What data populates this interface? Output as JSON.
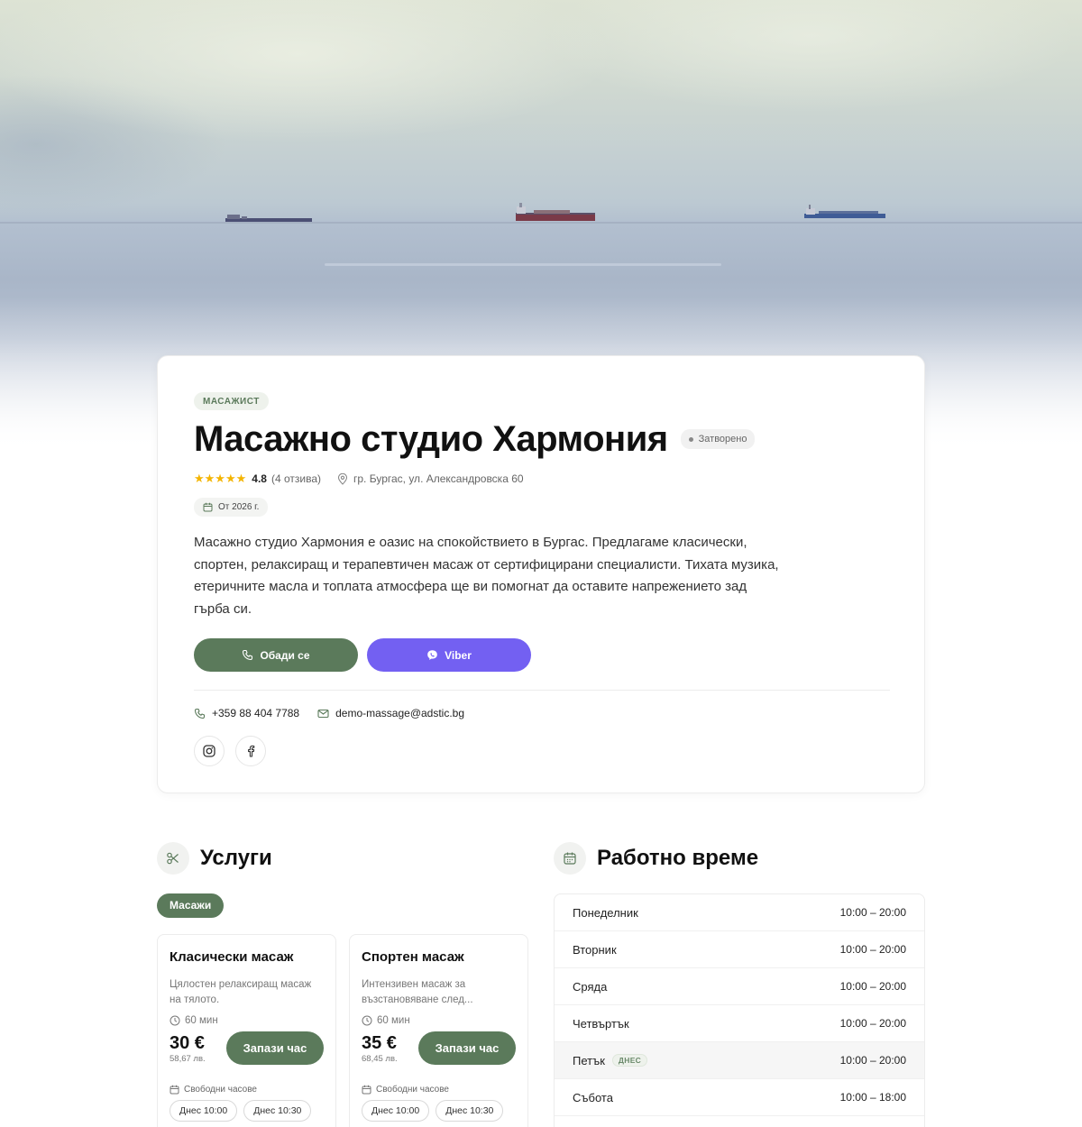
{
  "business": {
    "category": "МАСАЖИСТ",
    "name": "Масажно студио Хармония",
    "status": "Затворено",
    "stars": "★★★★★",
    "rating": "4.8",
    "reviews": "(4 отзива)",
    "address": "гр. Бургас, ул. Александровска 60",
    "since": "От 2026 г.",
    "description": "Масажно студио Хармония е оазис на спокойствието в Бургас. Предлагаме класически, спортен, релаксиращ и терапевтичен масаж от сертифицирани специалисти. Тихата музика, етеричните масла и топлата атмосфера ще ви помогнат да оставите напрежението зад гърба си.",
    "call_label": "Обади се",
    "viber_label": "Viber",
    "phone": "+359 88 404 7788",
    "email": "demo-massage@adstic.bg"
  },
  "services": {
    "title": "Услуги",
    "category_chip": "Масажи",
    "items": [
      {
        "name": "Класически масаж",
        "description": "Цялостен релаксиращ масаж на тялото.",
        "duration": "60 мин",
        "price": "30 €",
        "price_bgn": "58,67 лв.",
        "book_label": "Запази час",
        "slots_label": "Свободни часове",
        "slots": [
          "Днес 10:00",
          "Днес 10:30"
        ]
      },
      {
        "name": "Спортен масаж",
        "description": "Интензивен масаж за възстановяване след...",
        "duration": "60 мин",
        "price": "35 €",
        "price_bgn": "68,45 лв.",
        "book_label": "Запази час",
        "slots_label": "Свободни часове",
        "slots": [
          "Днес 10:00",
          "Днес 10:30"
        ]
      }
    ]
  },
  "hours": {
    "title": "Работно време",
    "today_badge": "ДНЕС",
    "days": [
      {
        "day": "Понеделник",
        "time": "10:00 – 20:00"
      },
      {
        "day": "Вторник",
        "time": "10:00 – 20:00"
      },
      {
        "day": "Сряда",
        "time": "10:00 – 20:00"
      },
      {
        "day": "Четвъртък",
        "time": "10:00 – 20:00"
      },
      {
        "day": "Петък",
        "time": "10:00 – 20:00"
      },
      {
        "day": "Събота",
        "time": "10:00 – 18:00"
      }
    ]
  },
  "colors": {
    "accent_green": "#5b7a5b",
    "viber_purple": "#7360f2",
    "star": "#f4b400"
  },
  "icons": [
    "phone-icon",
    "viber-icon",
    "mail-icon",
    "instagram-icon",
    "facebook-icon",
    "map-pin-icon",
    "calendar-icon",
    "scissors-icon",
    "clock-icon"
  ]
}
